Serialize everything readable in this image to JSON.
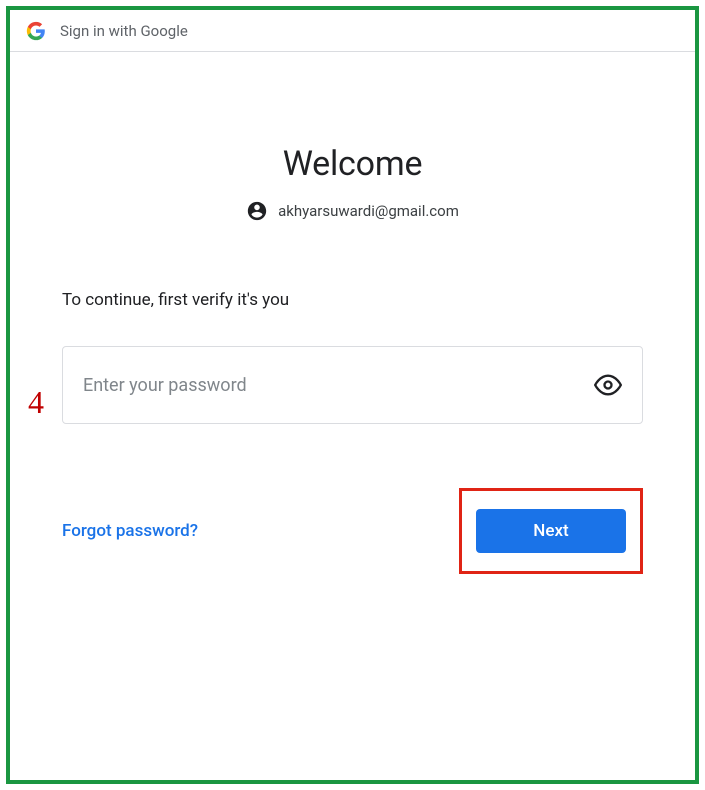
{
  "header": {
    "title": "Sign in with Google"
  },
  "main": {
    "welcome": "Welcome",
    "email": "akhyarsuwardi@gmail.com",
    "verify_text": "To continue, first verify it's you",
    "password_placeholder": "Enter your password"
  },
  "actions": {
    "forgot_label": "Forgot password?",
    "next_label": "Next"
  },
  "annotation": {
    "step": "4"
  }
}
